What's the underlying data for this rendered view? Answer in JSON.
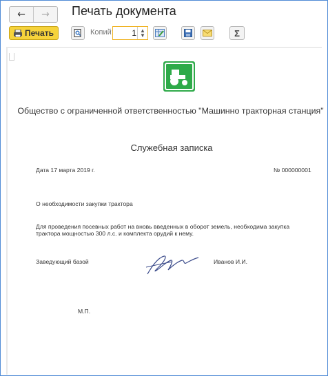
{
  "window": {
    "title": "Печать документа",
    "nav": {
      "back_icon": "arrow-left-icon",
      "forward_icon": "arrow-right-icon"
    }
  },
  "toolbar": {
    "print_label": "Печать",
    "copies_label": "Копий:",
    "copies_value": "1",
    "sum_label": "Σ",
    "accent_color": "#f6d33b"
  },
  "document": {
    "organization": "Общество с ограниченной ответственностью \"Машинно тракторная станция\"",
    "title": "Служебная записка",
    "date": "Дата 17 марта 2019 г.",
    "number": "№ 000000001",
    "subject": "О необходимости закупки трактора",
    "body_line1": "Для проведения посевных работ на вновь введенных в оборот земель, необходима закупка",
    "body_line2": "трактора мощностью 300 л.с. и комплекта орудий к нему.",
    "position": "Заведующий базой",
    "name": "Иванов И.И.",
    "stamp_place": "М.П."
  }
}
